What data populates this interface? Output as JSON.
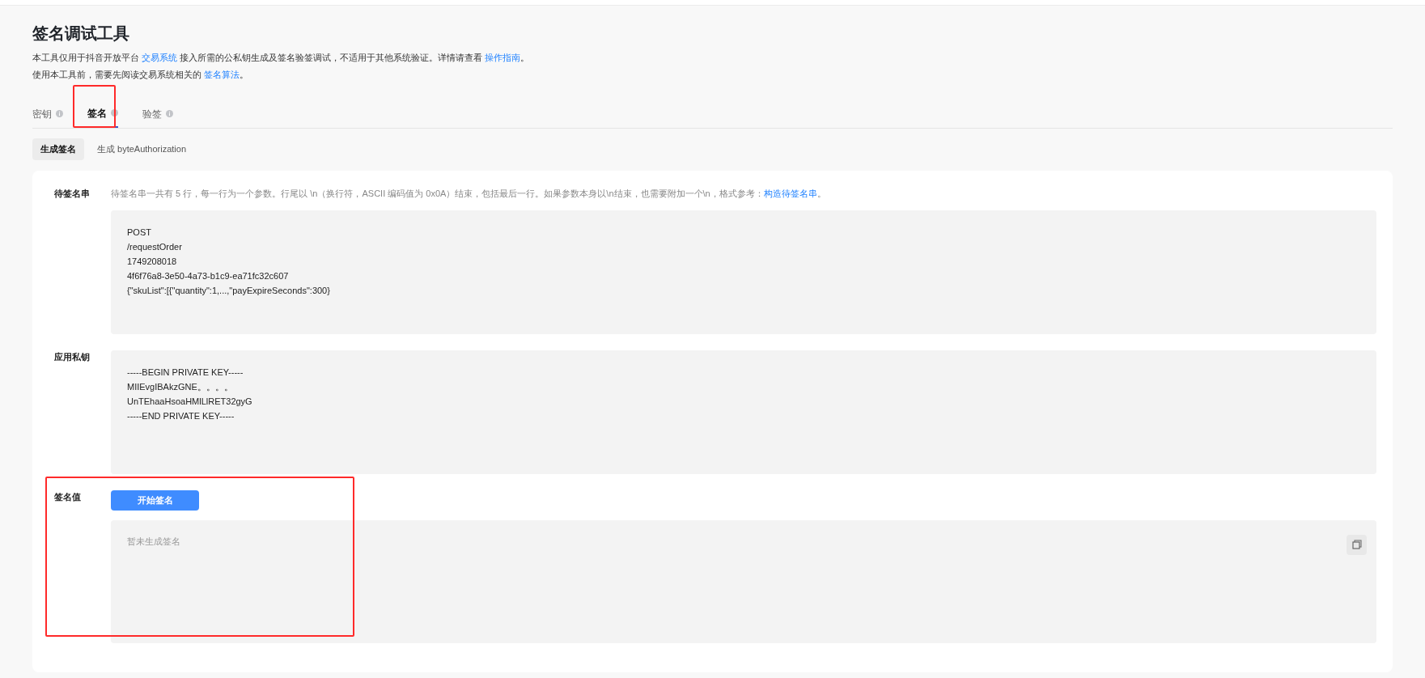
{
  "title": "签名调试工具",
  "description": [
    [
      "本工具仅用于抖音开放平台 ",
      {
        "link": "交易系统"
      },
      " 接入所需的公私钥生成及签名验签调试，不适用于其他系统验证。详情请查看 ",
      {
        "link": "操作指南"
      },
      "。"
    ],
    [
      "使用本工具前，需要先阅读交易系统相关的 ",
      {
        "link": "签名算法"
      },
      "。"
    ]
  ],
  "tabs": [
    {
      "label": "密钥",
      "selected": false
    },
    {
      "label": "签名",
      "selected": true
    },
    {
      "label": "验签",
      "selected": false
    }
  ],
  "subtabs": [
    {
      "label": "生成签名",
      "selected": true
    },
    {
      "label": "生成 byteAuthorization",
      "selected": false
    }
  ],
  "fields": [
    {
      "kind": "text",
      "label": "待签名串",
      "hint": [
        "待签名串一共有 5 行，每一行为一个参数。行尾以 \\n（换行符，ASCII 编码值为 0x0A）结束，包括最后一行。如果参数本身以\\n结束，也需要附加一个\\n，格式参考：",
        {
          "link": "构造待签名串"
        },
        "。"
      ],
      "lines": [
        "POST",
        "/requestOrder",
        "1749208018",
        "4f6f76a8-3e50-4a73-b1c9-ea71fc32c607",
        "{\"skuList\":[{\"quantity\":1,...,\"payExpireSeconds\":300}"
      ]
    },
    {
      "kind": "text",
      "label": "应用私钥",
      "lines": [
        "-----BEGIN PRIVATE KEY-----",
        "MIIEvgIBAkzGNE。。。。",
        "UnTEhaaHsoaHMlLlRET32gyG",
        "-----END PRIVATE KEY-----"
      ]
    },
    {
      "kind": "result",
      "label": "签名值",
      "button": "开始签名",
      "placeholder": "暂未生成签名"
    }
  ]
}
